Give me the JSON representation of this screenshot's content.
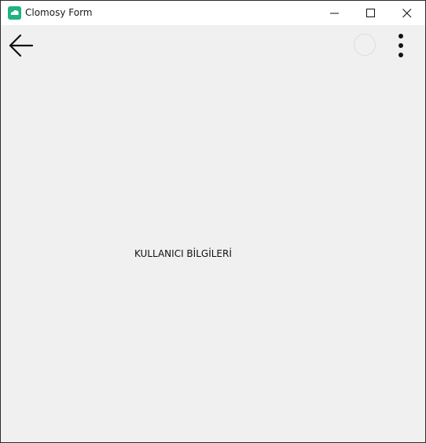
{
  "window": {
    "title": "Clomosy Form",
    "app_icon": "clomosy-logo-icon",
    "controls": {
      "minimize": "minimize-icon",
      "maximize": "maximize-icon",
      "close": "close-icon"
    }
  },
  "toolbar": {
    "back": "arrow-left-icon",
    "loading": "loading-spinner-icon",
    "menu": "more-vertical-icon"
  },
  "main": {
    "heading": "KULLANICI BİLGİLERİ"
  },
  "colors": {
    "brand": "#1fb37f",
    "background": "#f0f0f0",
    "titlebar": "#ffffff"
  }
}
